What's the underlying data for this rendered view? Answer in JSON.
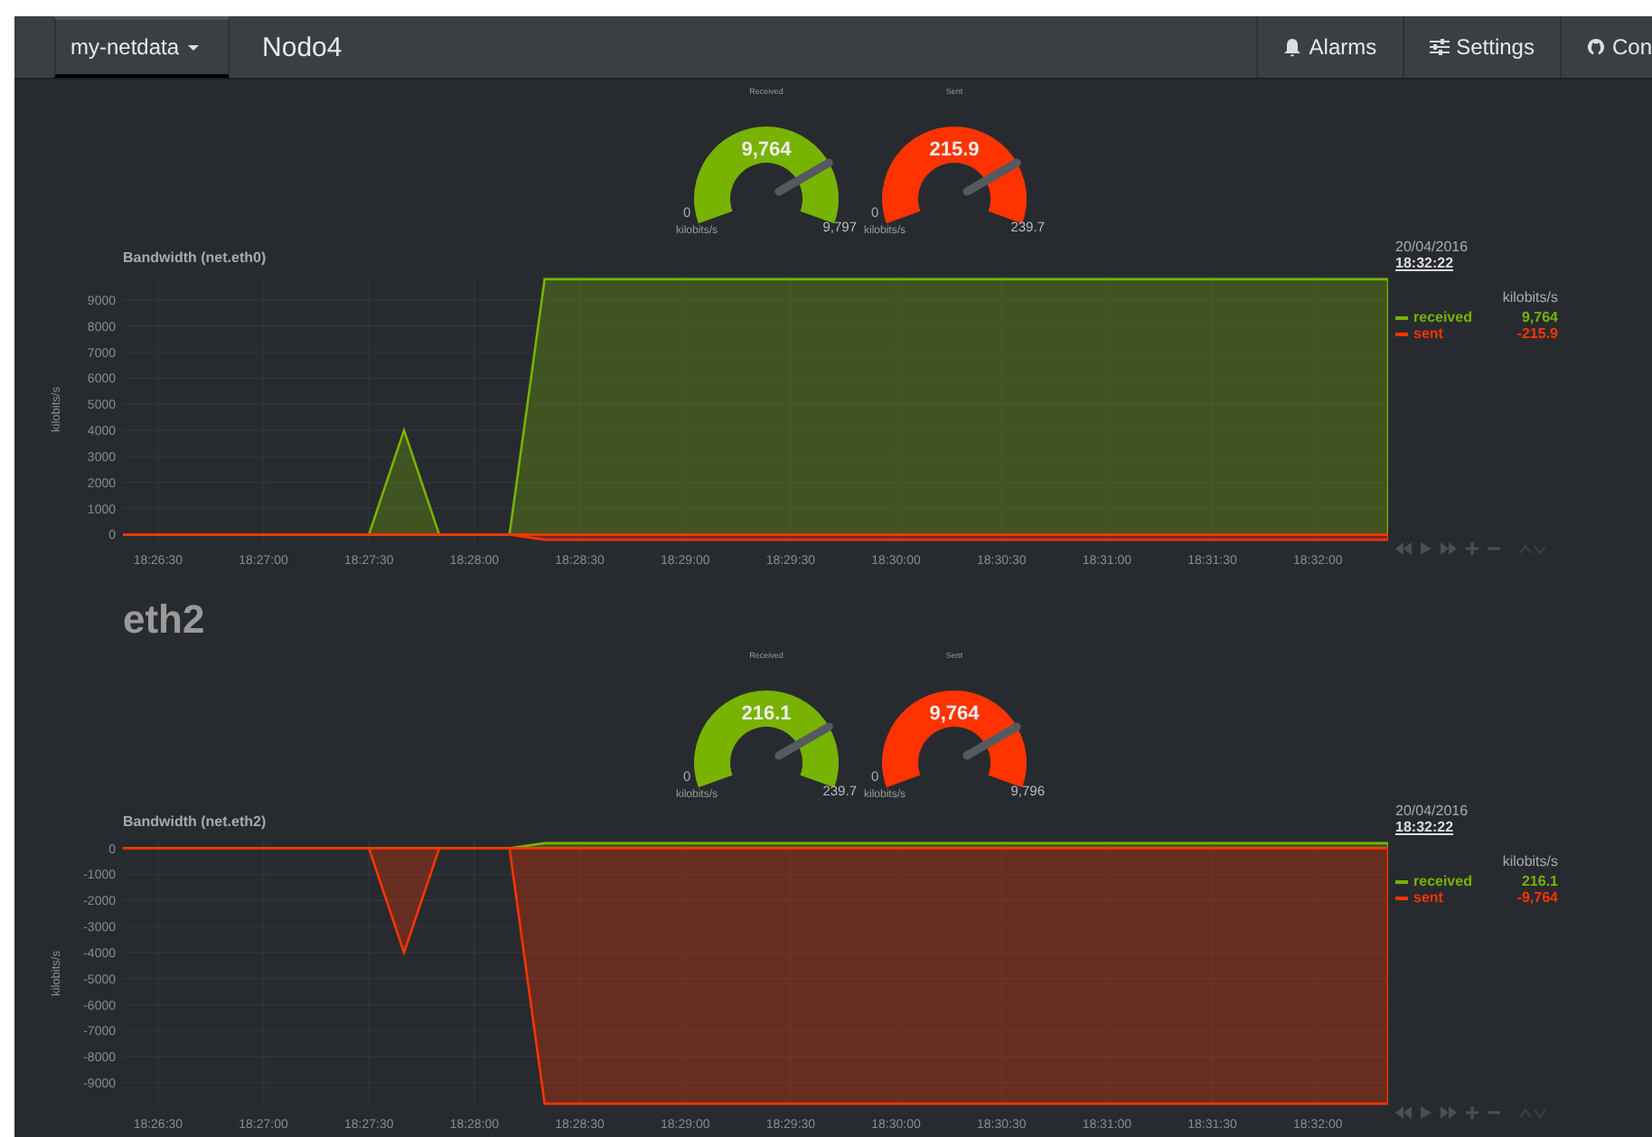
{
  "navbar": {
    "brand": "my-netdata",
    "host": "Nodo4",
    "items": [
      {
        "kind": "alarms",
        "label": "Alarms"
      },
      {
        "kind": "settings",
        "label": "Settings"
      },
      {
        "kind": "github",
        "label": "Con"
      }
    ]
  },
  "sections": [
    {
      "gauges": [
        {
          "title": "Received",
          "value": "9,764",
          "min": "0",
          "max": "9,797",
          "unit": "kilobits/s",
          "color": "#77b300"
        },
        {
          "title": "Sent",
          "value": "215.9",
          "min": "0",
          "max": "239.7",
          "unit": "kilobits/s",
          "color": "#ff3300"
        }
      ],
      "chart": {
        "title": "Bandwidth (net.eth0)",
        "date": "20/04/2016",
        "time": "18:32:22",
        "unit": "kilobits/s",
        "legend_values": [
          "9,764",
          "-215.9"
        ],
        "chart_data": {
          "type": "area",
          "ylabel": "kilobits/s",
          "categories": [
            null,
            "18:26:30",
            null,
            null,
            "18:27:00",
            null,
            null,
            "18:27:30",
            null,
            null,
            "18:28:00",
            null,
            null,
            "18:28:30",
            null,
            null,
            "18:29:00",
            null,
            null,
            "18:29:30",
            null,
            null,
            "18:30:00",
            null,
            null,
            "18:30:30",
            null,
            null,
            "18:31:00",
            null,
            null,
            "18:31:30",
            null,
            null,
            "18:32:00",
            null,
            null
          ],
          "series": [
            {
              "name": "received",
              "color": "#77b300",
              "values": [
                0,
                0,
                0,
                0,
                0,
                0,
                0,
                0,
                4000,
                0,
                0,
                0,
                9800,
                9800,
                9800,
                9800,
                9800,
                9800,
                9800,
                9800,
                9800,
                9800,
                9800,
                9800,
                9800,
                9800,
                9800,
                9800,
                9800,
                9800,
                9800,
                9800,
                9800,
                9800,
                9800,
                9800,
                9800
              ]
            },
            {
              "name": "sent",
              "color": "#ff3300",
              "values": [
                0,
                0,
                0,
                0,
                0,
                0,
                0,
                0,
                0,
                0,
                0,
                0,
                -200,
                -200,
                -200,
                -200,
                -200,
                -200,
                -200,
                -200,
                -200,
                -200,
                -200,
                -200,
                -200,
                -200,
                -200,
                -200,
                -200,
                -200,
                -200,
                -200,
                -200,
                -200,
                -200,
                -200,
                -200
              ]
            }
          ],
          "ylim": [
            -300,
            9900
          ],
          "grid": true,
          "yticks": [
            0,
            1000,
            2000,
            3000,
            4000,
            5000,
            6000,
            7000,
            8000,
            9000
          ]
        }
      }
    },
    {
      "heading": "eth2",
      "gauges": [
        {
          "title": "Received",
          "value": "216.1",
          "min": "0",
          "max": "239.7",
          "unit": "kilobits/s",
          "color": "#77b300"
        },
        {
          "title": "Sent",
          "value": "9,764",
          "min": "0",
          "max": "9,796",
          "unit": "kilobits/s",
          "color": "#ff3300"
        }
      ],
      "chart": {
        "title": "Bandwidth (net.eth2)",
        "date": "20/04/2016",
        "time": "18:32:22",
        "unit": "kilobits/s",
        "legend_values": [
          "216.1",
          "-9,764"
        ],
        "chart_data": {
          "type": "area",
          "ylabel": "kilobits/s",
          "categories": [
            null,
            "18:26:30",
            null,
            null,
            "18:27:00",
            null,
            null,
            "18:27:30",
            null,
            null,
            "18:28:00",
            null,
            null,
            "18:28:30",
            null,
            null,
            "18:29:00",
            null,
            null,
            "18:29:30",
            null,
            null,
            "18:30:00",
            null,
            null,
            "18:30:30",
            null,
            null,
            "18:31:00",
            null,
            null,
            "18:31:30",
            null,
            null,
            "18:32:00",
            null,
            null
          ],
          "series": [
            {
              "name": "received",
              "color": "#77b300",
              "values": [
                0,
                0,
                0,
                0,
                0,
                0,
                0,
                0,
                0,
                0,
                0,
                0,
                200,
                200,
                200,
                200,
                200,
                200,
                200,
                200,
                200,
                200,
                200,
                200,
                200,
                200,
                200,
                200,
                200,
                200,
                200,
                200,
                200,
                200,
                200,
                200,
                200
              ]
            },
            {
              "name": "sent",
              "color": "#ff3300",
              "values": [
                0,
                0,
                0,
                0,
                0,
                0,
                0,
                0,
                -4000,
                0,
                0,
                0,
                -9800,
                -9800,
                -9800,
                -9800,
                -9800,
                -9800,
                -9800,
                -9800,
                -9800,
                -9800,
                -9800,
                -9800,
                -9800,
                -9800,
                -9800,
                -9800,
                -9800,
                -9800,
                -9800,
                -9800,
                -9800,
                -9800,
                -9800,
                -9800,
                -9800
              ]
            }
          ],
          "ylim": [
            -9900,
            300
          ],
          "grid": true,
          "yticks": [
            0,
            -1000,
            -2000,
            -3000,
            -4000,
            -5000,
            -6000,
            -7000,
            -8000,
            -9000
          ]
        }
      }
    }
  ]
}
